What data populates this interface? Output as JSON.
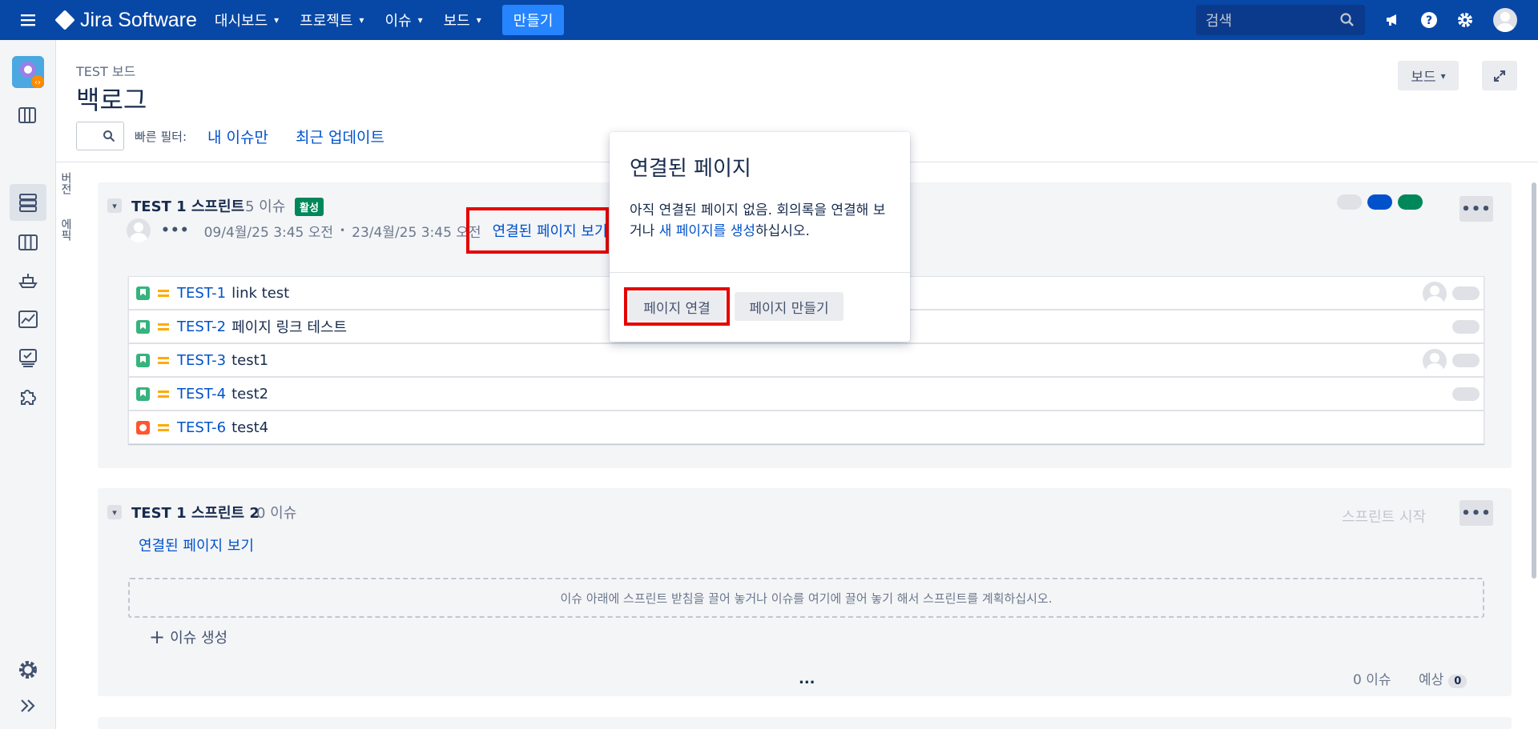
{
  "topbar": {
    "app_name": "Jira Software",
    "nav": [
      {
        "label": "대시보드"
      },
      {
        "label": "프로젝트"
      },
      {
        "label": "이슈"
      },
      {
        "label": "보드"
      }
    ],
    "create_label": "만들기",
    "search_placeholder": "검색"
  },
  "sidebar": {
    "icons": [
      "project-avatar-icon",
      "board-icon",
      "backlog-icon",
      "active-sprints-icon",
      "releases-icon",
      "reports-icon",
      "issues-icon",
      "add-ons-icon",
      "settings-icon",
      "expand-icon"
    ],
    "vertical_tabs": [
      "버전",
      "에픽"
    ]
  },
  "header": {
    "breadcrumb": "TEST 보드",
    "title": "백로그",
    "board_button": "보드"
  },
  "filters": {
    "label": "빠른 필터:",
    "items": [
      "내 이슈만",
      "최근 업데이트"
    ]
  },
  "sprint1": {
    "name": "TEST 1 스프린트",
    "count": "5 이슈",
    "status": "활성",
    "date_start": "09/4월/25 3:45 오전",
    "bullet": "•",
    "date_end": "23/4월/25 3:45 오전",
    "linked_pages": "연결된 페이지 보기",
    "status_pills": [
      "#dfe1e6",
      "#0052cc",
      "#00875a"
    ],
    "issues": [
      {
        "key": "TEST-1",
        "summary": "link test",
        "type": "story",
        "assignee": true
      },
      {
        "key": "TEST-2",
        "summary": "페이지 링크 테스트",
        "type": "story",
        "assignee": false
      },
      {
        "key": "TEST-3",
        "summary": "test1",
        "type": "story",
        "assignee": true
      },
      {
        "key": "TEST-4",
        "summary": "test2",
        "type": "story",
        "assignee": false
      },
      {
        "key": "TEST-6",
        "summary": "test4",
        "type": "bug",
        "assignee": false
      }
    ]
  },
  "sprint2": {
    "name": "TEST 1 스프린트 2",
    "count": "0 이슈",
    "linked_pages": "연결된 페이지 보기",
    "start_label": "스프린트 시작",
    "empty_text": "이슈 아래에 스프린트 받침을 끌어 놓거나 이슈를 여기에 끌어 놓기 해서 스프린트를 계획하십시오.",
    "create_issue": "이슈 생성",
    "ellipsis": "...",
    "footer_count": "0 이슈",
    "footer_estimate_label": "예상",
    "footer_estimate_value": "0"
  },
  "popup": {
    "title": "연결된 페이지",
    "text_before": "아직 연결된 페이지 없음. 회의록을 연결해 보거나 ",
    "text_link": "새 페이지를 생성",
    "text_after": "하십시오.",
    "link_button": "페이지 연결",
    "create_button": "페이지 만들기"
  },
  "colors": {
    "topbar": "#0747a6",
    "link": "#0052cc",
    "highlight": "#e60000",
    "active_badge": "#00875a"
  }
}
